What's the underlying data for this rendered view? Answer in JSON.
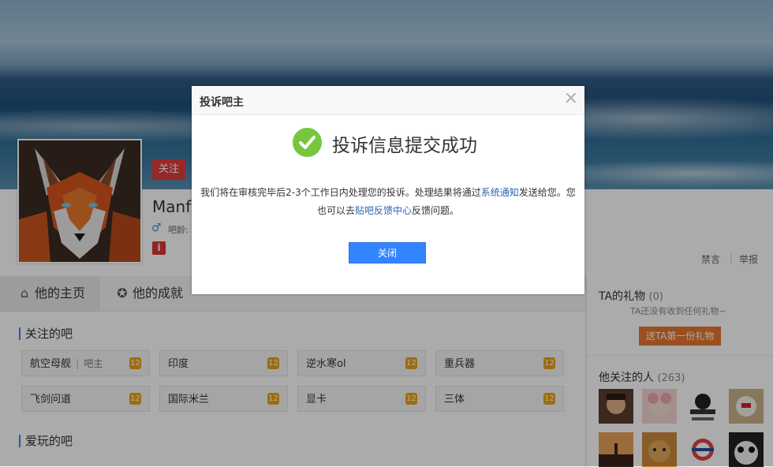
{
  "profile": {
    "follow_label": "关注",
    "username": "Manfr",
    "bar_age": "吧龄:",
    "ban_label": "禁言",
    "separator": "|",
    "report_label": "举报"
  },
  "tabs": [
    {
      "label": "他的主页",
      "icon": "home-icon",
      "active": true
    },
    {
      "label": "他的成就",
      "icon": "medal-icon",
      "active": false
    }
  ],
  "followed_bars": {
    "title": "关注的吧",
    "items": [
      {
        "name": "航空母舰",
        "role": "吧主",
        "level": "12"
      },
      {
        "name": "印度",
        "level": "12"
      },
      {
        "name": "逆水寒ol",
        "level": "12"
      },
      {
        "name": "重兵器",
        "level": "12"
      },
      {
        "name": "飞剑问道",
        "level": "12"
      },
      {
        "name": "国际米兰",
        "level": "12"
      },
      {
        "name": "显卡",
        "level": "12"
      },
      {
        "name": "三体",
        "level": "12"
      }
    ]
  },
  "played_bars": {
    "title": "爱玩的吧"
  },
  "sidebar": {
    "gifts_title": "TA的礼物",
    "gifts_count": "(0)",
    "gifts_empty": "TA还没有收到任何礼物~",
    "gift_button": "送TA第一份礼物",
    "following_title": "他关注的人",
    "following_count": "(263)"
  },
  "dialog": {
    "title": "投诉吧主",
    "close_icon": "×",
    "success_title": "投诉信息提交成功",
    "text_part1": "我们将在审核完毕后2-3个工作日内处理您的投诉。处理结果将通过",
    "link_system": "系统通知",
    "text_part2": "发送给您。您也可以去",
    "link_feedback": "贴吧反馈中心",
    "text_part3": "反馈问题。",
    "close_button": "关闭"
  },
  "colors": {
    "accent_blue": "#3385ff",
    "success_green": "#76c73b",
    "follow_red": "#e03c3c",
    "gift_orange": "#e4762f",
    "level_gold": "#e8a317"
  }
}
